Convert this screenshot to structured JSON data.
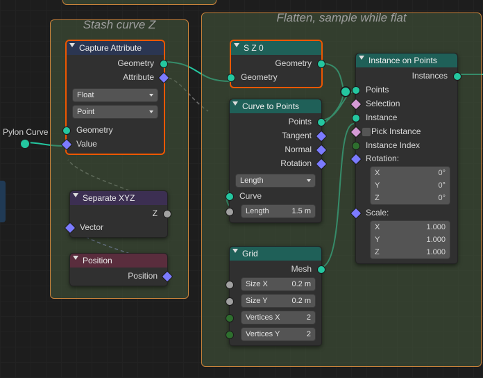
{
  "external": {
    "pylon_label": "Pylon Curve"
  },
  "frames": {
    "stash": {
      "title": "Stash curve Z"
    },
    "flatten": {
      "title": "Flatten, sample while flat"
    }
  },
  "nodes": {
    "capture": {
      "title": "Capture Attribute",
      "out_geometry": "Geometry",
      "out_attribute": "Attribute",
      "dtype": "Float",
      "domain": "Point",
      "in_geometry": "Geometry",
      "in_value": "Value"
    },
    "sepxyz": {
      "title": "Separate XYZ",
      "out_z": "Z",
      "in_vector": "Vector"
    },
    "position": {
      "title": "Position",
      "out_position": "Position"
    },
    "sz0": {
      "title": "S Z 0",
      "out_geometry": "Geometry",
      "in_geometry": "Geometry"
    },
    "ctp": {
      "title": "Curve to Points",
      "out_points": "Points",
      "out_tangent": "Tangent",
      "out_normal": "Normal",
      "out_rotation": "Rotation",
      "mode": "Length",
      "in_curve": "Curve",
      "length_label": "Length",
      "length_value": "1.5 m"
    },
    "grid": {
      "title": "Grid",
      "out_mesh": "Mesh",
      "sizex_label": "Size X",
      "sizex_value": "0.2 m",
      "sizey_label": "Size Y",
      "sizey_value": "0.2 m",
      "vx_label": "Vertices X",
      "vx_value": "2",
      "vy_label": "Vertices Y",
      "vy_value": "2"
    },
    "iop": {
      "title": "Instance on Points",
      "out_instances": "Instances",
      "in_points": "Points",
      "in_selection": "Selection",
      "in_instance": "Instance",
      "pick_instance": "Pick Instance",
      "in_instance_index": "Instance Index",
      "rotation_label": "Rotation:",
      "rot_x_l": "X",
      "rot_x_v": "0°",
      "rot_y_l": "Y",
      "rot_y_v": "0°",
      "rot_z_l": "Z",
      "rot_z_v": "0°",
      "scale_label": "Scale:",
      "scl_x_l": "X",
      "scl_x_v": "1.000",
      "scl_y_l": "Y",
      "scl_y_v": "1.000",
      "scl_z_l": "Z",
      "scl_z_v": "1.000"
    }
  }
}
